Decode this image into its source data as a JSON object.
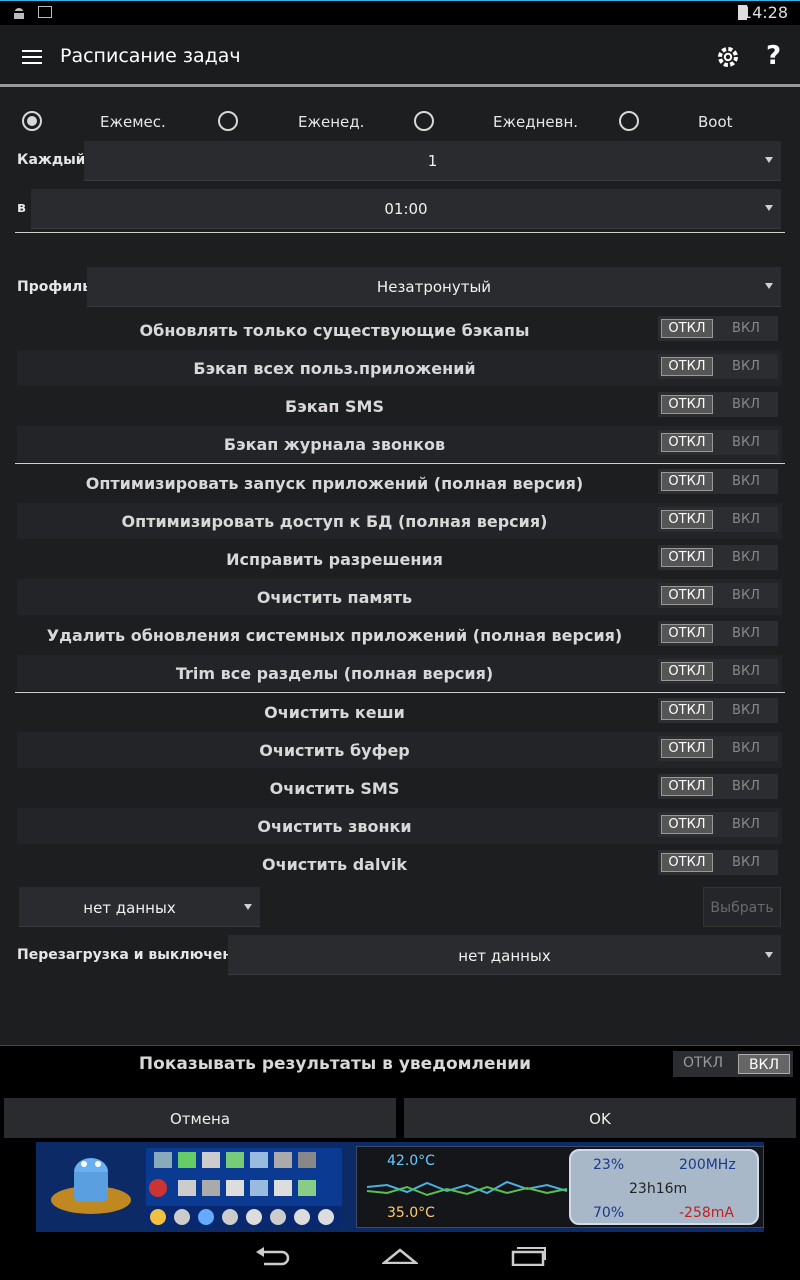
{
  "status": {
    "time": "14:28"
  },
  "appbar": {
    "title": "Расписание задач"
  },
  "schedule": {
    "options": [
      {
        "label": "Ежемес.",
        "selected": true
      },
      {
        "label": "Еженед.",
        "selected": false
      },
      {
        "label": "Ежедневн.",
        "selected": false
      },
      {
        "label": "Boot",
        "selected": false
      }
    ],
    "every_label": "Каждый",
    "every_value": "1",
    "at_label": "в",
    "at_value": "01:00"
  },
  "profile": {
    "label": "Профиль",
    "value": "Незатронутый"
  },
  "toggle_labels": {
    "off": "ОТКЛ",
    "on": "ВКЛ"
  },
  "group1": [
    "Обновлять только существующие бэкапы",
    "Бэкап всех польз.приложений",
    "Бэкап SMS",
    "Бэкап журнала звонков"
  ],
  "group2": [
    "Оптимизировать запуск приложений (полная версия)",
    "Оптимизировать доступ к БД (полная версия)",
    "Исправить разрешения",
    "Очистить память",
    "Удалить обновления системных приложений (полная версия)",
    "Trim все разделы (полная версия)"
  ],
  "group3": [
    "Очистить кеши",
    "Очистить буфер",
    "Очистить SMS",
    "Очистить звонки",
    "Очистить dalvik"
  ],
  "extra": {
    "dropdown_value": "нет данных",
    "choose_button": "Выбрать",
    "reboot_label": "Перезагрузка и выключение",
    "reboot_value": "нет данных"
  },
  "notify": {
    "label": "Показывать результаты в уведомлении",
    "off": "ОТКЛ",
    "on": "ВКЛ"
  },
  "buttons": {
    "cancel": "Отмена",
    "ok": "OK"
  },
  "ad": {
    "temp1": "42.0°C",
    "temp2": "35.0°C",
    "cpu_pct": "23%",
    "freq": "200MHz",
    "uptime": "23h16m",
    "battery_pct": "70%",
    "current": "-258mA"
  }
}
